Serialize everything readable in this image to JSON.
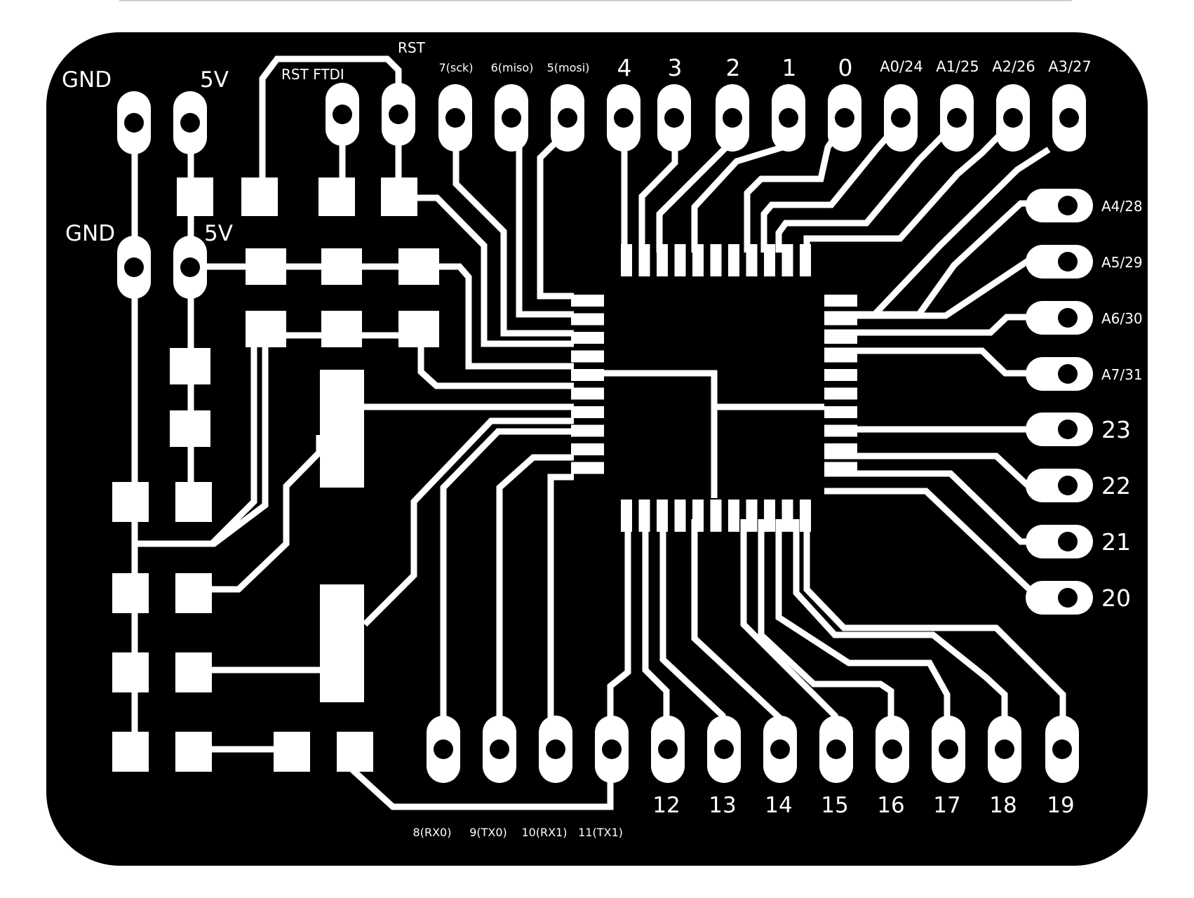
{
  "board": {
    "background": "#000000",
    "copper": "#ffffff",
    "hole": "#000000"
  },
  "labels": {
    "gnd_top": "GND",
    "vcc_top": "5V",
    "gnd_mid": "GND",
    "vcc_mid": "5V",
    "rst": "RST",
    "rst_ftdi": "RST FTDI"
  },
  "header_top": [
    "7(sck)",
    "6(miso)",
    "5(mosi)",
    "4",
    "3",
    "2",
    "1",
    "0",
    "A0/24",
    "A1/25",
    "A2/26",
    "A3/27"
  ],
  "header_right": [
    "A4/28",
    "A5/29",
    "A6/30",
    "A7/31",
    "23",
    "22",
    "21",
    "20"
  ],
  "header_bottom_left": [
    "8(RX0)",
    "9(TX0)",
    "10(RX1)",
    "11(TX1)"
  ],
  "header_bottom_right": [
    "12",
    "13",
    "14",
    "15",
    "16",
    "17",
    "18",
    "19"
  ]
}
